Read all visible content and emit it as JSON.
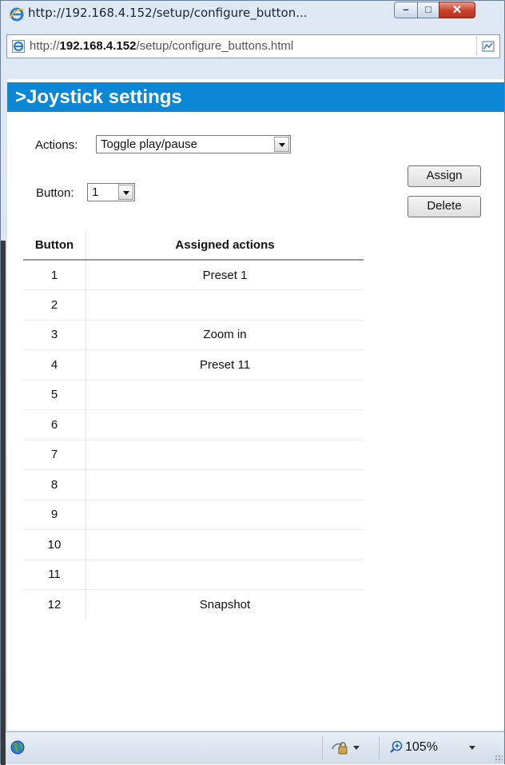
{
  "window": {
    "title": "http://192.168.4.152/setup/configure_button...",
    "minimize_icon": "minimize-icon",
    "maximize_icon": "maximize-icon",
    "close_icon": "close-icon"
  },
  "address_bar": {
    "url_prefix": "http://",
    "url_host": "192.168.4.152",
    "url_path": "/setup/configure_buttons.html",
    "compat_icon": "compatibility-view-icon"
  },
  "page": {
    "heading": ">Joystick settings",
    "accent_color": "#0c87d6",
    "actions_label": "Actions:",
    "actions_selected": "Toggle play/pause",
    "button_label": "Button:",
    "button_selected": "1",
    "assign_label": "Assign",
    "delete_label": "Delete"
  },
  "table": {
    "headers": [
      "Button",
      "Assigned actions"
    ],
    "rows": [
      [
        "1",
        "Preset 1"
      ],
      [
        "2",
        ""
      ],
      [
        "3",
        "Zoom in"
      ],
      [
        "4",
        "Preset 11"
      ],
      [
        "5",
        ""
      ],
      [
        "6",
        ""
      ],
      [
        "7",
        ""
      ],
      [
        "8",
        ""
      ],
      [
        "9",
        ""
      ],
      [
        "10",
        ""
      ],
      [
        "11",
        ""
      ],
      [
        "12",
        "Snapshot"
      ]
    ]
  },
  "status_bar": {
    "zone_icon": "internet-globe-icon",
    "security_icon": "protected-mode-icon",
    "zoom_icon": "zoom-magnifier-icon",
    "zoom_level": "105%"
  }
}
